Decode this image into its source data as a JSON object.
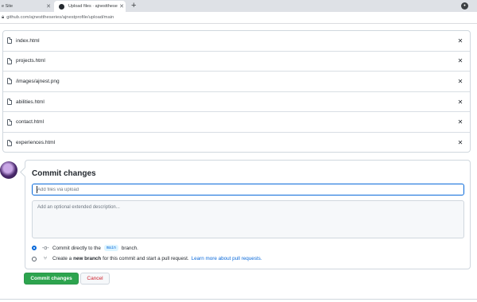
{
  "browser": {
    "tabs": [
      {
        "title": "e Site",
        "active": false
      },
      {
        "title": "Upload files · ajnesttheseries/ajn",
        "active": true
      }
    ],
    "new_tab": "+",
    "url": "github.com/ajnesttheseries/ajnestprofile/upload/main"
  },
  "files": [
    {
      "name": "index.html"
    },
    {
      "name": "projects.html"
    },
    {
      "name": "/images/ajnest.png"
    },
    {
      "name": "abilities.html"
    },
    {
      "name": "contact.html"
    },
    {
      "name": "experiences.html"
    }
  ],
  "commit": {
    "title": "Commit changes",
    "summary_placeholder": "Add files via upload",
    "description_placeholder": "Add an optional extended description...",
    "option_direct": {
      "prefix": "Commit directly to the",
      "branch": "main",
      "suffix": "branch.",
      "selected": true
    },
    "option_new_branch": {
      "prefix": "Create a",
      "bold": "new branch",
      "middle": "for this commit and start a pull request.",
      "link": "Learn more about pull requests.",
      "selected": false
    }
  },
  "buttons": {
    "commit": "Commit changes",
    "cancel": "Cancel"
  },
  "colors": {
    "accent": "#0969da",
    "commit_button": "#2da44e",
    "cancel_text": "#cf222e"
  }
}
